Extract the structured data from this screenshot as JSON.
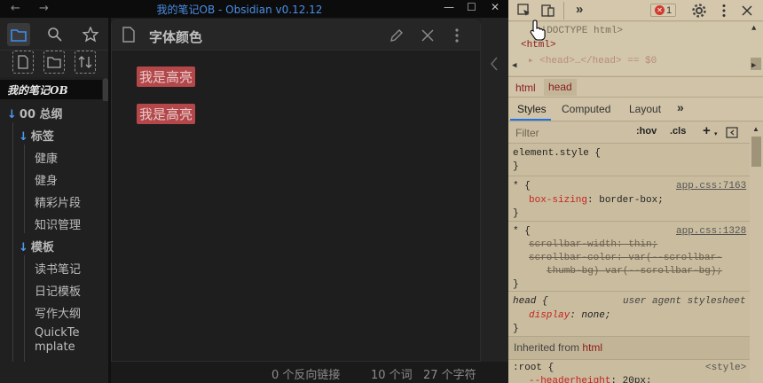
{
  "window": {
    "title": "我的笔记OB - Obsidian v0.12.12",
    "back_glyph": "←",
    "forward_glyph": "→",
    "minimize_glyph": "—",
    "maximize_glyph": "☐",
    "close_glyph": "✕"
  },
  "sidebar": {
    "vault_name": "我的笔记OB",
    "tree": [
      {
        "label": "00 总纲",
        "type": "folder",
        "expanded": true
      },
      {
        "label": "标签",
        "type": "folder",
        "expanded": true
      },
      {
        "label": "健康",
        "type": "file"
      },
      {
        "label": "健身",
        "type": "file"
      },
      {
        "label": "精彩片段",
        "type": "file"
      },
      {
        "label": "知识管理",
        "type": "file"
      },
      {
        "label": "模板",
        "type": "folder",
        "expanded": true
      },
      {
        "label": "读书笔记",
        "type": "file"
      },
      {
        "label": "日记模板",
        "type": "file"
      },
      {
        "label": "写作大纲",
        "type": "file"
      },
      {
        "label": "QuickTe",
        "type": "file"
      },
      {
        "label": "mplate",
        "type": "file"
      }
    ],
    "arrow_glyph": "↓"
  },
  "note": {
    "title": "字体颜色",
    "highlights": [
      "我是高亮",
      "我是高亮"
    ],
    "highlight_color": "#b3474a"
  },
  "status": {
    "backlinks": "0 个反向链接",
    "words": "10 个词",
    "chars": "27 个字符"
  },
  "devtools": {
    "more_tabs": "»",
    "error_count": "1",
    "dom": {
      "doctype": "<!DOCTYPE html>",
      "html_open": "<html>",
      "head_line": "▸ <head>…</head> == $0"
    },
    "breadcrumbs": [
      "html",
      "head"
    ],
    "tabs": [
      "Styles",
      "Computed",
      "Layout",
      "»"
    ],
    "filter_placeholder": "Filter",
    "hov": ":hov",
    "cls": ".cls",
    "plus": "+",
    "rules": {
      "element_style": "element.style {",
      "close_brace": "}",
      "r1_selector": "* {",
      "r1_source": "app.css:7163",
      "r1_prop": "box-sizing",
      "r1_value": "border-box;",
      "r2_selector": "* {",
      "r2_source": "app.css:1328",
      "r2_line1": "scrollbar-width: thin;",
      "r2_line2": "scrollbar-color: var(--scrollbar-",
      "r2_line3": "thumb-bg) var(--scrollbar-bg);",
      "r3_selector": "head {",
      "r3_source": "user agent stylesheet",
      "r3_prop": "display",
      "r3_value": "none;",
      "inherited_label": "Inherited from",
      "inherited_from": "html",
      "root_selector": ":root {",
      "root_source": "<style>",
      "root_prop": "--headerheight",
      "root_value": "20px;"
    }
  }
}
